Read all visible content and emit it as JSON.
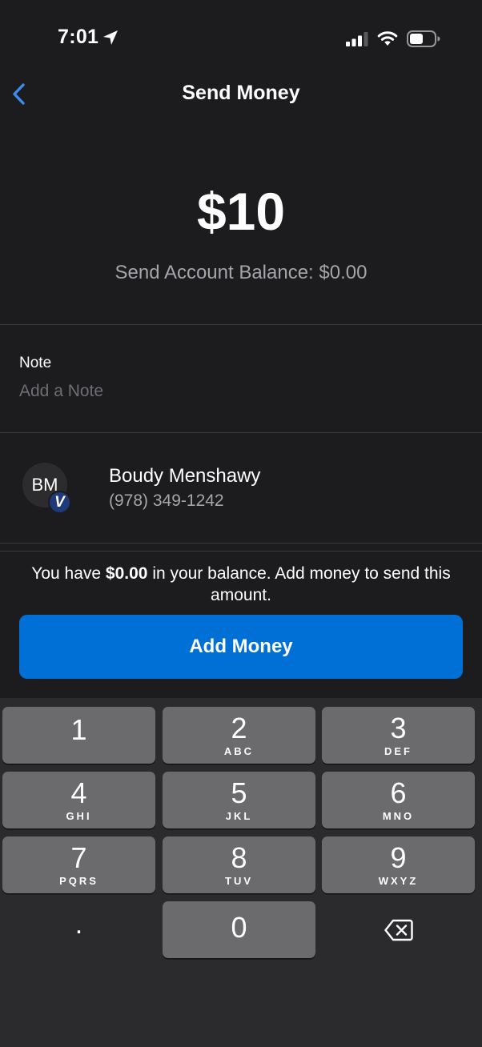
{
  "status_bar": {
    "time": "7:01"
  },
  "nav": {
    "title": "Send Money"
  },
  "amount": "$10",
  "send_account_balance": "Send Account Balance: $0.00",
  "note": {
    "label": "Note",
    "placeholder": "Add a Note",
    "value": ""
  },
  "recipient": {
    "initials": "BM",
    "badge": "V",
    "name": "Boudy Menshawy",
    "phone": "(978) 349-1242"
  },
  "balance_message": {
    "prefix": "You have ",
    "amount": "$0.00",
    "suffix": " in your balance. Add money to send this amount."
  },
  "add_money_button": "Add Money",
  "keypad": {
    "keys": [
      {
        "digit": "1",
        "letters": ""
      },
      {
        "digit": "2",
        "letters": "ABC"
      },
      {
        "digit": "3",
        "letters": "DEF"
      },
      {
        "digit": "4",
        "letters": "GHI"
      },
      {
        "digit": "5",
        "letters": "JKL"
      },
      {
        "digit": "6",
        "letters": "MNO"
      },
      {
        "digit": "7",
        "letters": "PQRS"
      },
      {
        "digit": "8",
        "letters": "TUV"
      },
      {
        "digit": "9",
        "letters": "WXYZ"
      }
    ],
    "decimal": ".",
    "zero": "0",
    "delete_icon": "backspace-icon"
  },
  "colors": {
    "background": "#1c1c1e",
    "accent_blue": "#0070d6",
    "back_chevron": "#3d8cf0",
    "key": "#6b6b6e",
    "keypad_background": "#2b2b2d"
  }
}
